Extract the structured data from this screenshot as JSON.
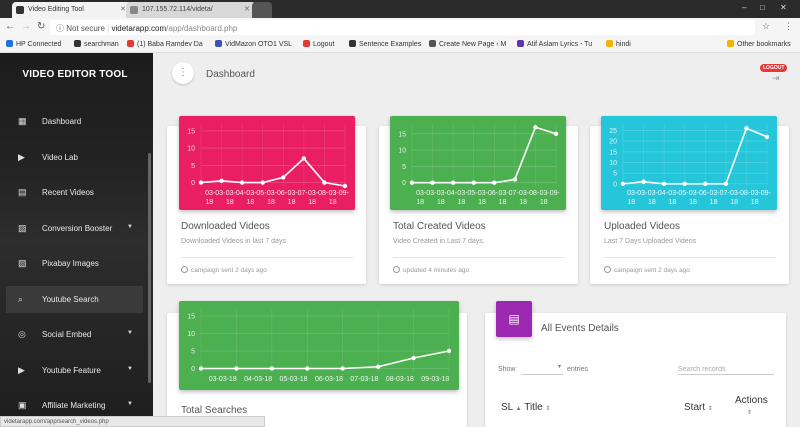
{
  "browser": {
    "tabs": [
      {
        "title": "Video Editing Tool"
      },
      {
        "title": "107.155.72.114/videta/"
      }
    ],
    "address": {
      "not_secure": "Not secure",
      "domain": "videtarapp.com",
      "path": "/app/dashboard.php"
    },
    "bookmarks": [
      {
        "label": "HP Connected",
        "color": "#1a73e8"
      },
      {
        "label": "searchman",
        "color": "#333333"
      },
      {
        "label": "(1) Baba Ramdev Da",
        "color": "#e53935"
      },
      {
        "label": "VidMazon OTO1 VSL",
        "color": "#3f51b5"
      },
      {
        "label": "Logout",
        "color": "#e53935"
      },
      {
        "label": "Sentence Examples",
        "color": "#333333"
      },
      {
        "label": "Create New Page ‹ M",
        "color": "#555555"
      },
      {
        "label": "Atif Aslam Lyrics - Tu",
        "color": "#5e35b1"
      },
      {
        "label": "hindi",
        "color": "#f4b400"
      },
      {
        "label": "Other bookmarks",
        "color": "#f4b400"
      }
    ],
    "status_url": "videtarapp.com/app/search_videos.php"
  },
  "sidebar": {
    "brand": "VIDEO EDITOR TOOL",
    "items": [
      {
        "label": "Dashboard",
        "icon": "dashboard-icon",
        "glyph": "▦",
        "caret": ""
      },
      {
        "label": "Video Lab",
        "icon": "video-camera-icon",
        "glyph": "▶",
        "caret": ""
      },
      {
        "label": "Recent Videos",
        "icon": "recent-videos-icon",
        "glyph": "▤",
        "caret": ""
      },
      {
        "label": "Conversion Booster",
        "icon": "image-icon",
        "glyph": "▨",
        "caret": "▼"
      },
      {
        "label": "Pixabay Images",
        "icon": "pixabay-icon",
        "glyph": "▧",
        "caret": ""
      },
      {
        "label": "Youtube Search",
        "icon": "search-icon",
        "glyph": "⌕",
        "caret": ""
      },
      {
        "label": "Social Embed",
        "icon": "globe-icon",
        "glyph": "◎",
        "caret": "▼"
      },
      {
        "label": "Youtube Feature",
        "icon": "youtube-icon",
        "glyph": "▶",
        "caret": "▼"
      },
      {
        "label": "Affiliate Marketing",
        "icon": "affiliate-icon",
        "glyph": "▣",
        "caret": "▼"
      }
    ]
  },
  "header": {
    "menu_glyph": "⋮",
    "title": "Dashboard",
    "logout_badge": "LOGOUT"
  },
  "cards": [
    {
      "title": "Downloaded Videos",
      "subtitle": "Downloaded Videos in last 7 days",
      "footer": "campaign sent 2 days ago",
      "color": "#e91e63"
    },
    {
      "title": "Total Created Videos",
      "subtitle": "Video Created in Last 7 days.",
      "footer": "updated 4 minutes ago",
      "color": "#4caf50"
    },
    {
      "title": "Uploaded Videos",
      "subtitle": "Last 7 Days Uploaded Videos",
      "footer": "campaign sent 2 days ago",
      "color": "#26c6da"
    },
    {
      "title": "Total Searches",
      "color": "#4caf50"
    }
  ],
  "events": {
    "title": "All Events Details",
    "show": "Show",
    "entries": "entries",
    "search_placeholder": "Search records",
    "columns": {
      "sl": "SL",
      "title": "Title",
      "start": "Start",
      "actions": "Actions"
    }
  },
  "chart_data": [
    {
      "type": "line",
      "x": [
        "03-03-18",
        "03-04-18",
        "03-05-18",
        "03-06-18",
        "03-07-18",
        "03-08-18",
        "03-09-18"
      ],
      "x_ticks": [
        {
          "l1": "03-03-",
          "l2": "18"
        },
        {
          "l1": "03-04-",
          "l2": "18"
        },
        {
          "l1": "03-05-",
          "l2": "18"
        },
        {
          "l1": "03-06-",
          "l2": "18"
        },
        {
          "l1": "03-07-",
          "l2": "18"
        },
        {
          "l1": "03-08-",
          "l2": "18"
        },
        {
          "l1": "03-09-",
          "l2": "18"
        }
      ],
      "values": [
        0,
        0.5,
        0,
        0,
        1.5,
        7,
        0
      ],
      "points": [
        0,
        0.5,
        0,
        0,
        1.5,
        7,
        0,
        -1
      ],
      "yticks": [
        0,
        5,
        10,
        15
      ],
      "ylim": [
        -1,
        17
      ]
    },
    {
      "type": "line",
      "x": [
        "03-03-18",
        "03-04-18",
        "03-05-18",
        "03-06-18",
        "03-07-18",
        "03-08-18",
        "03-09-18"
      ],
      "x_ticks": [
        {
          "l1": "03-03-",
          "l2": "18"
        },
        {
          "l1": "03-04-",
          "l2": "18"
        },
        {
          "l1": "03-05-",
          "l2": "18"
        },
        {
          "l1": "03-06-",
          "l2": "18"
        },
        {
          "l1": "03-07-",
          "l2": "18"
        },
        {
          "l1": "03-08-",
          "l2": "18"
        },
        {
          "l1": "03-09-",
          "l2": "18"
        }
      ],
      "points": [
        0,
        0,
        0,
        0,
        0,
        1,
        17,
        15
      ],
      "yticks": [
        0,
        5,
        10,
        15
      ],
      "ylim": [
        -1,
        18
      ]
    },
    {
      "type": "line",
      "x": [
        "03-03-18",
        "03-04-18",
        "03-05-18",
        "03-06-18",
        "03-07-18",
        "03-08-18",
        "03-09-18"
      ],
      "x_ticks": [
        {
          "l1": "03-03-",
          "l2": "18"
        },
        {
          "l1": "03-04-",
          "l2": "18"
        },
        {
          "l1": "03-05-",
          "l2": "18"
        },
        {
          "l1": "03-06-",
          "l2": "18"
        },
        {
          "l1": "03-07-",
          "l2": "18"
        },
        {
          "l1": "03-08-",
          "l2": "18"
        },
        {
          "l1": "03-09-",
          "l2": "18"
        }
      ],
      "points": [
        0,
        1,
        0,
        0,
        0,
        0,
        26,
        22
      ],
      "yticks": [
        0,
        5,
        10,
        15,
        20,
        25
      ],
      "ylim": [
        -1,
        28
      ]
    },
    {
      "type": "line",
      "x": [
        "03-03-18",
        "03-04-18",
        "03-05-18",
        "03-06-18",
        "03-07-18",
        "03-08-18",
        "09-03-18"
      ],
      "x_ticks": [
        {
          "l1": "03-03-18",
          "l2": ""
        },
        {
          "l1": "04-03-18",
          "l2": ""
        },
        {
          "l1": "05-03-18",
          "l2": ""
        },
        {
          "l1": "06-03-18",
          "l2": ""
        },
        {
          "l1": "07-03-18",
          "l2": ""
        },
        {
          "l1": "08-03-18",
          "l2": ""
        },
        {
          "l1": "09-03-18",
          "l2": ""
        }
      ],
      "points": [
        0,
        0,
        0,
        0,
        0,
        0.5,
        3,
        5
      ],
      "yticks": [
        0,
        5,
        10,
        15
      ],
      "ylim": [
        -1,
        17
      ]
    }
  ]
}
